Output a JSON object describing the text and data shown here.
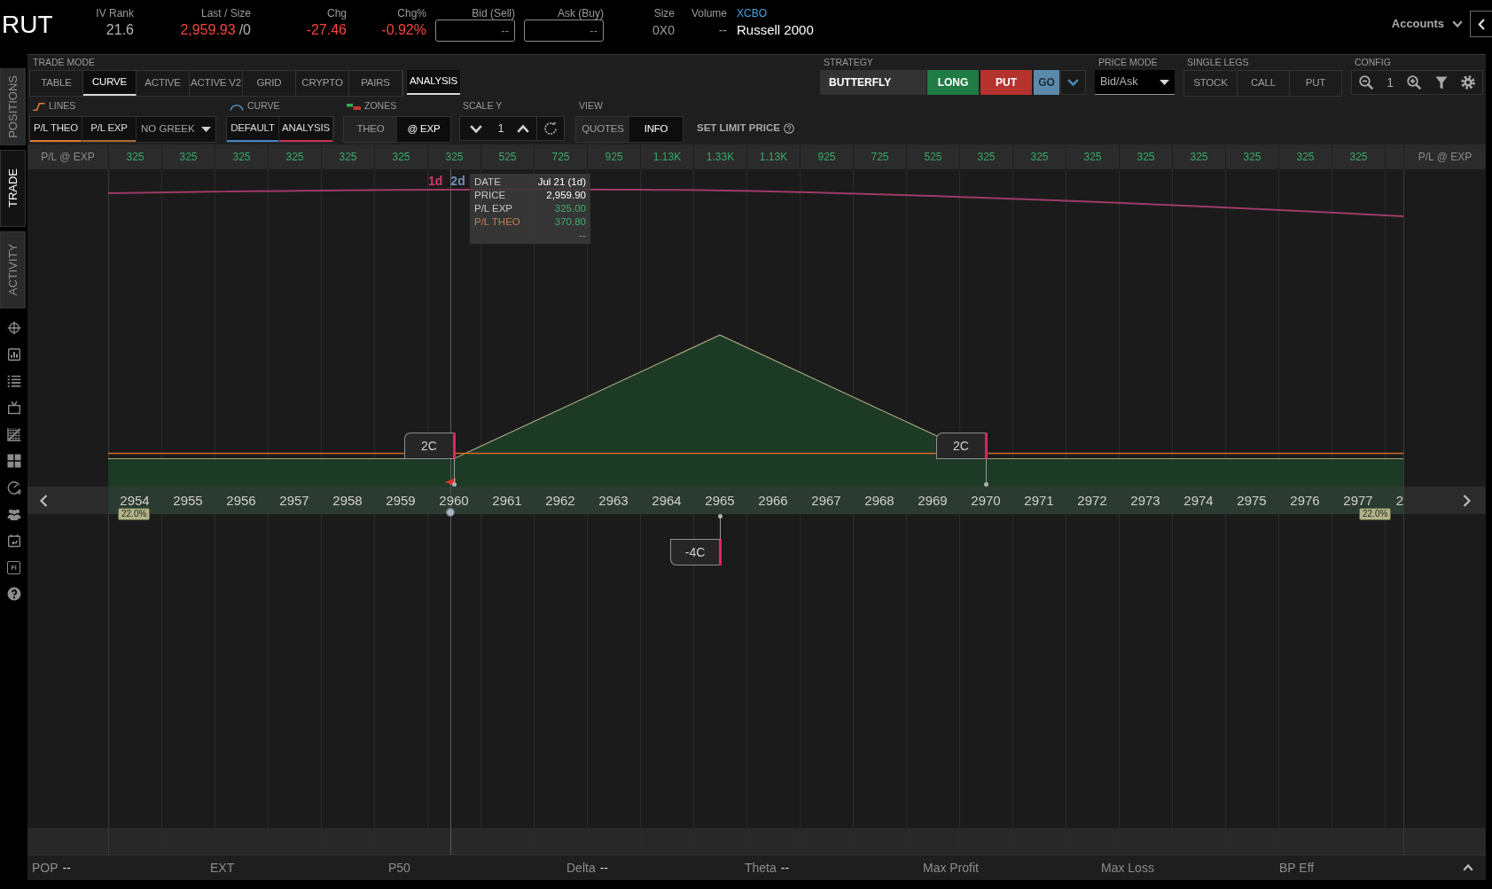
{
  "header": {
    "symbol": "RUT",
    "iv_rank": {
      "label": "IV Rank",
      "value": "21.6"
    },
    "last_size": {
      "label": "Last / Size",
      "last": "2,959.93",
      "size": "/0",
      "negative": true
    },
    "change": {
      "label": "Chg",
      "value": "-27.46",
      "negative": true
    },
    "change_percent": {
      "label": "Chg%",
      "value": "-0.92%",
      "negative": true
    },
    "bid": {
      "label": "Bid (Sell)",
      "value": "--"
    },
    "ask": {
      "label": "Ask (Buy)",
      "value": "--"
    },
    "size": {
      "label": "Size",
      "value": "0X0"
    },
    "volume": {
      "label": "Volume",
      "value": "--"
    },
    "exchange": "XCBO",
    "description": "Russell 2000",
    "accounts": "Accounts"
  },
  "sidebar": {
    "tabs": [
      {
        "label": "POSITIONS",
        "selected": false
      },
      {
        "label": "TRADE",
        "selected": true
      },
      {
        "label": "ACTIVITY",
        "selected": false
      }
    ],
    "fi_icon_text": "FI"
  },
  "toolbar": {
    "trade_mode": {
      "label": "TRADE MODE",
      "tabs": [
        {
          "label": "TABLE",
          "selected": false
        },
        {
          "label": "CURVE",
          "selected": true
        },
        {
          "label": "ACTIVE",
          "selected": false
        },
        {
          "label": "ACTIVE V2",
          "selected": false
        },
        {
          "label": "GRID",
          "selected": false
        },
        {
          "label": "CRYPTO",
          "selected": false
        },
        {
          "label": "PAIRS",
          "selected": false
        }
      ],
      "analysis": {
        "label": "ANALYSIS",
        "on": true
      }
    },
    "lines": {
      "label": "LINES",
      "buttons": [
        {
          "label": "P/L THEO",
          "color": "#e07a35"
        },
        {
          "label": "P/L EXP",
          "color": "#a8692f"
        }
      ],
      "greek": "NO GREEK"
    },
    "curve": {
      "label": "CURVE",
      "buttons": [
        {
          "label": "DEFAULT",
          "color": "#3f86c4"
        },
        {
          "label": "ANALYSIS",
          "color": "#c8304e"
        }
      ]
    },
    "zones": {
      "label": "ZONES",
      "options": [
        {
          "label": "THEO",
          "selected": false
        },
        {
          "label": "@ EXP",
          "selected": true
        }
      ]
    },
    "scale_y": {
      "label": "SCALE Y",
      "value": "1"
    },
    "view": {
      "label": "VIEW",
      "options": [
        {
          "label": "QUOTES",
          "selected": false
        },
        {
          "label": "INFO",
          "selected": true
        }
      ]
    },
    "set_limit_price": "SET LIMIT PRICE",
    "strategy": {
      "label": "STRATEGY",
      "name": "BUTTERFLY",
      "side": "LONG",
      "option_type": "PUT",
      "go": "GO"
    },
    "price_mode": {
      "label": "PRICE MODE",
      "value": "Bid/Ask"
    },
    "single_legs": {
      "label": "SINGLE LEGS",
      "buttons": [
        "STOCK",
        "CALL",
        "PUT"
      ]
    },
    "config": {
      "label": "CONFIG",
      "zoom": "1"
    }
  },
  "chart": {
    "row_label_left": "P/L @ EXP",
    "row_label_right": "P/L @ EXP",
    "pl_at_exp": [
      "325",
      "325",
      "325",
      "325",
      "325",
      "325",
      "325",
      "525",
      "725",
      "925",
      "1.13K",
      "1.33K",
      "1.13K",
      "925",
      "725",
      "525",
      "325",
      "325",
      "325",
      "325",
      "325",
      "325",
      "325",
      "325"
    ],
    "strikes": [
      {
        "label": "2954"
      },
      {
        "label": "2955"
      },
      {
        "label": "2956"
      },
      {
        "label": "2957"
      },
      {
        "label": "2958"
      },
      {
        "label": "2959"
      },
      {
        "label": "2960",
        "legs": [
          {
            "label": "2C",
            "kind": "long"
          }
        ]
      },
      {
        "label": "2961"
      },
      {
        "label": "2962"
      },
      {
        "label": "2963"
      },
      {
        "label": "2964"
      },
      {
        "label": "2965",
        "legs": [
          {
            "label": "-4C",
            "kind": "short"
          }
        ]
      },
      {
        "label": "2966"
      },
      {
        "label": "2967"
      },
      {
        "label": "2968"
      },
      {
        "label": "2969"
      },
      {
        "label": "2970",
        "legs": [
          {
            "label": "2C",
            "kind": "long"
          }
        ]
      },
      {
        "label": "2971"
      },
      {
        "label": "2972"
      },
      {
        "label": "2973"
      },
      {
        "label": "2974"
      },
      {
        "label": "2975"
      },
      {
        "label": "2976"
      },
      {
        "label": "2977"
      }
    ],
    "partial_strike": "2",
    "iv_badges": [
      "22.0%",
      "22.0%"
    ],
    "cursor_days": [
      {
        "label": "1d",
        "color": "#d6336c"
      },
      {
        "label": "2d",
        "color": "#6d8fb3"
      }
    ],
    "tooltip": [
      {
        "label": "DATE",
        "value": "Jul 21 (1d)",
        "kind": "info"
      },
      {
        "label": "PRICE",
        "value": "2,959.90",
        "kind": "info"
      },
      {
        "label": "P/L EXP",
        "value": "325.00",
        "kind": "pl_exp"
      },
      {
        "label": "P/L THEO",
        "value": "370.80",
        "kind": "pl_theo"
      },
      {
        "value": "--",
        "kind": "extra"
      }
    ]
  },
  "footer": [
    {
      "label": "POP",
      "value": "--"
    },
    {
      "label": "EXT"
    },
    {
      "label": "P50"
    },
    {
      "label": "Delta",
      "value": "--"
    },
    {
      "label": "Theta",
      "value": "--"
    },
    {
      "label": "Max Profit"
    },
    {
      "label": "Max Loss"
    },
    {
      "label": "BP Eff"
    }
  ]
}
